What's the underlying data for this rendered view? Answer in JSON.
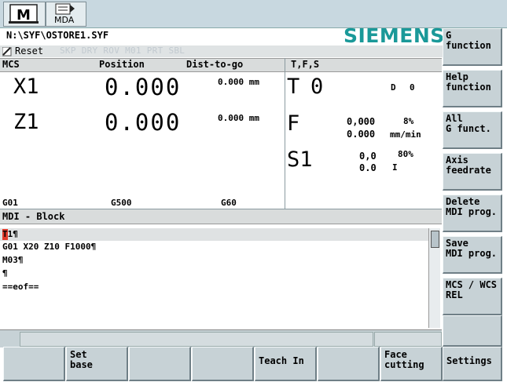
{
  "top": {
    "mode_label": "MDA"
  },
  "path": "N:\\SYF\\OSTORE1.SYF",
  "brand": "SIEMENS",
  "status": {
    "reset": "Reset",
    "flags": "SKP DRY ROV M01 PRT SBL"
  },
  "mcs_panel": {
    "header_mcs": "MCS",
    "header_position": "Position",
    "header_dist": "Dist-to-go",
    "axes": [
      {
        "name": "X1",
        "position": "0.000",
        "dist": "0.000 mm"
      },
      {
        "name": "Z1",
        "position": "0.000",
        "dist": "0.000 mm"
      }
    ],
    "gcodes": [
      "G01",
      "G500",
      "G60"
    ]
  },
  "tfs_panel": {
    "header": "T,F,S",
    "t_label": "T",
    "t_value": "0",
    "d_label": "D",
    "d_value": "0",
    "f_label": "F",
    "f_value1": "0,000",
    "f_value2": "0.000",
    "f_percent": "8%",
    "f_unit": "mm/min",
    "s_label": "S1",
    "s_value1": "0,0",
    "s_value2": "0.0",
    "s_percent": "80%",
    "s_unit": "I"
  },
  "mdi": {
    "header": "MDI - Block",
    "lines": [
      "T1¶",
      "G01 X20 Z10 F1000¶",
      "M03¶",
      "¶",
      "==eof=="
    ]
  },
  "vertical_softkeys": [
    [
      "G",
      "function"
    ],
    [
      "Help",
      "function"
    ],
    [
      "All",
      "G funct."
    ],
    [
      "Axis",
      "feedrate"
    ],
    [
      "Delete",
      "MDI prog."
    ],
    [
      "Save",
      "MDI prog."
    ],
    [
      "MCS / WCS",
      "REL"
    ],
    [
      "",
      ""
    ]
  ],
  "horizontal_softkeys": [
    [
      "",
      ""
    ],
    [
      "Set",
      "base"
    ],
    [
      "",
      ""
    ],
    [
      "",
      ""
    ],
    [
      "Teach In",
      ""
    ],
    [
      "",
      ""
    ],
    [
      "Face",
      "cutting"
    ],
    [
      "Settings",
      ""
    ]
  ],
  "colors": {
    "brand": "#1a9999",
    "topbar": "#c8d8e0",
    "softkey": "#c7d2d6",
    "cursor": "#e03a2a"
  }
}
